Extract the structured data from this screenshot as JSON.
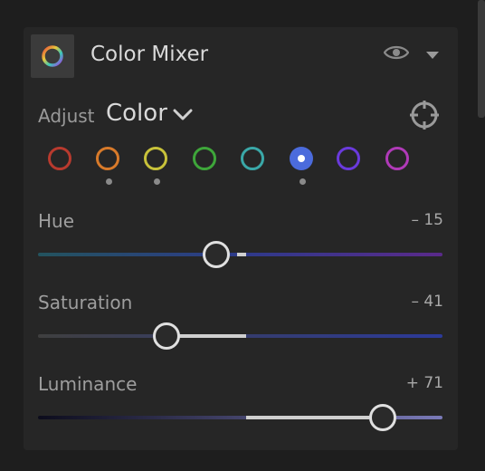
{
  "panel": {
    "title": "Color Mixer"
  },
  "adjust": {
    "label": "Adjust",
    "value": "Color"
  },
  "swatches": [
    {
      "color": "#b83a2e",
      "selected": false,
      "edited": false
    },
    {
      "color": "#d87a2a",
      "selected": false,
      "edited": true
    },
    {
      "color": "#c8c23a",
      "selected": false,
      "edited": true
    },
    {
      "color": "#3ea63a",
      "selected": false,
      "edited": false
    },
    {
      "color": "#3aa8a8",
      "selected": false,
      "edited": false
    },
    {
      "color": "#4b6bdc",
      "selected": true,
      "edited": true
    },
    {
      "color": "#6a3adc",
      "selected": false,
      "edited": false
    },
    {
      "color": "#b03ab8",
      "selected": false,
      "edited": false
    }
  ],
  "sliders": {
    "hue": {
      "label": "Hue",
      "value": "– 15",
      "track_colors": [
        "#23535e",
        "#2d3a8a",
        "#5a2a8a"
      ]
    },
    "saturation": {
      "label": "Saturation",
      "value": "– 41",
      "track_colors": [
        "#3f3f3f",
        "#2c3a9a"
      ]
    },
    "luminance": {
      "label": "Luminance",
      "value": "+ 71",
      "track_colors": [
        "#0c0c1c",
        "#7a7ab8"
      ]
    }
  }
}
